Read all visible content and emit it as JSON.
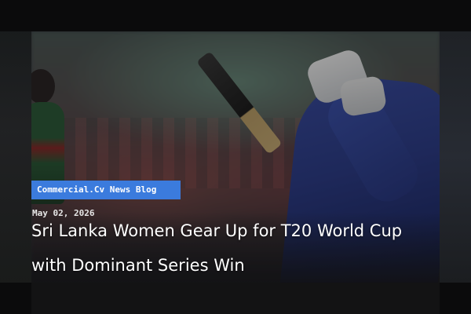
{
  "post": {
    "category": "Commercial.Cv News Blog",
    "date": "May 02, 2026",
    "title": "Sri Lanka Women Gear Up for T20 World Cup with Dominant Series Win"
  },
  "colors": {
    "tag_background": "#3b7bdd",
    "page_background": "#0b0b0c",
    "headline_text": "#ffffff"
  },
  "image": {
    "subject": "cricket batter in blue kit mid-swing with fielder in green and red kit"
  }
}
